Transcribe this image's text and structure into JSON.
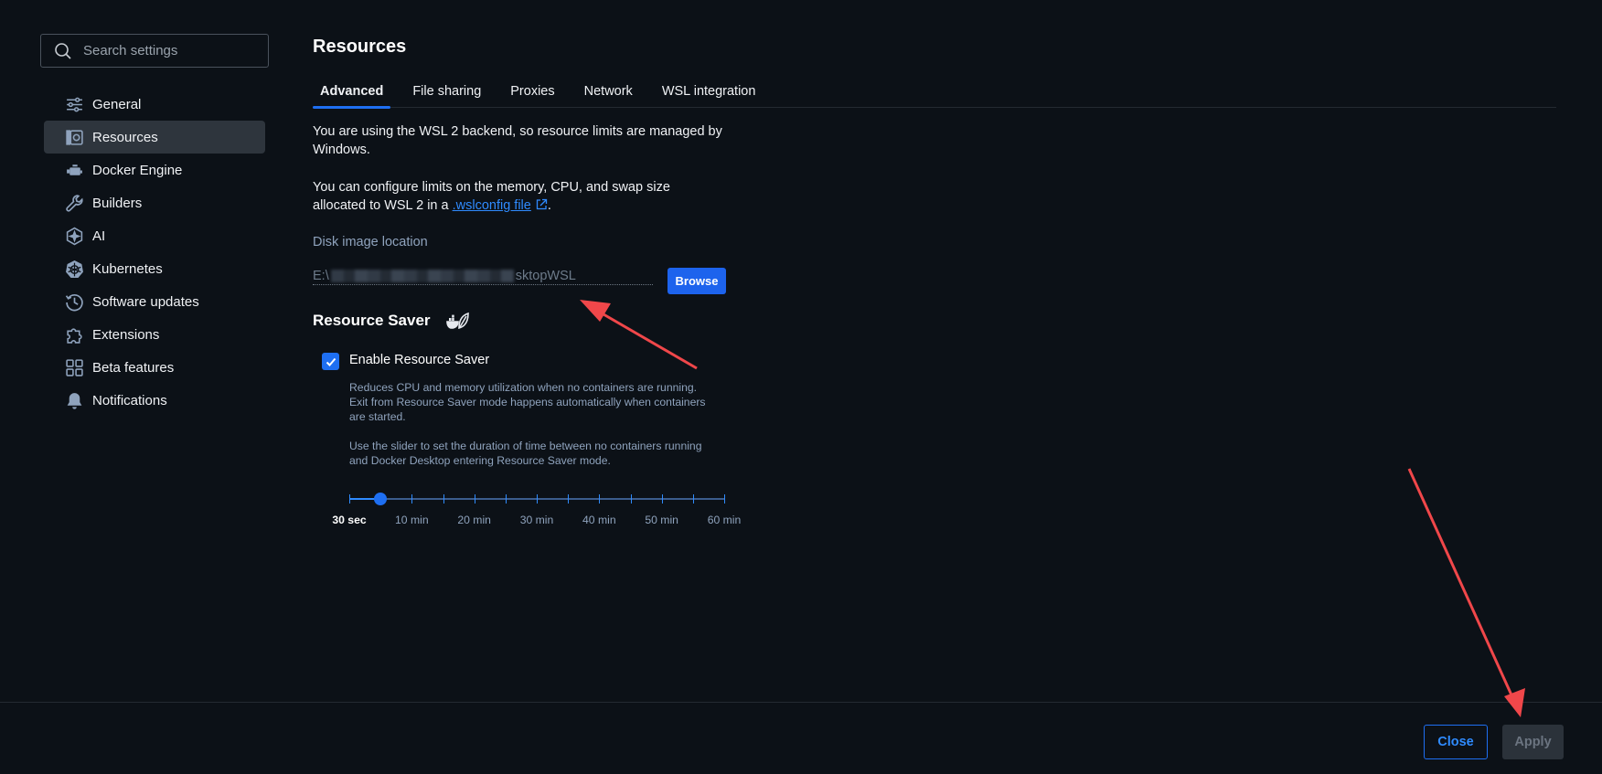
{
  "sidebar": {
    "search_placeholder": "Search settings",
    "items": [
      {
        "label": "General",
        "icon": "sliders-icon"
      },
      {
        "label": "Resources",
        "icon": "resources-icon",
        "active": true
      },
      {
        "label": "Docker Engine",
        "icon": "docker-engine-icon"
      },
      {
        "label": "Builders",
        "icon": "wrench-icon"
      },
      {
        "label": "AI",
        "icon": "ai-icon"
      },
      {
        "label": "Kubernetes",
        "icon": "kubernetes-icon"
      },
      {
        "label": "Software updates",
        "icon": "clock-icon"
      },
      {
        "label": "Extensions",
        "icon": "puzzle-icon"
      },
      {
        "label": "Beta features",
        "icon": "grid-icon"
      },
      {
        "label": "Notifications",
        "icon": "bell-icon"
      }
    ]
  },
  "main": {
    "title": "Resources",
    "tabs": [
      {
        "label": "Advanced",
        "active": true
      },
      {
        "label": "File sharing"
      },
      {
        "label": "Proxies"
      },
      {
        "label": "Network"
      },
      {
        "label": "WSL integration"
      }
    ],
    "wsl_text_1": "You are using the WSL 2 backend, so resource limits are managed by",
    "wsl_text_1b": "Windows.",
    "wsl_text_2a": "You can configure limits on the memory, CPU, and swap size",
    "wsl_text_2b": "allocated to WSL 2 in a ",
    "wsl_link": ".wslconfig file",
    "wsl_text_2c": ".",
    "disk_label": "Disk image location",
    "disk_path_prefix": "E:\\",
    "disk_path_suffix": "sktopWSL",
    "browse_label": "Browse",
    "resource_saver": {
      "title": "Resource Saver",
      "checkbox_label": "Enable Resource Saver",
      "enabled": true,
      "desc_1": [
        "Reduces CPU and memory utilization when no containers are running.",
        "Exit from Resource Saver mode happens automatically when containers",
        "are started."
      ],
      "desc_2": [
        "Use the slider to set the duration of time between no containers running",
        "and Docker Desktop entering Resource Saver mode."
      ],
      "slider": {
        "labels": [
          "30 sec",
          "10 min",
          "20 min",
          "30 min",
          "40 min",
          "50 min",
          "60 min"
        ],
        "steps": 13,
        "value_index": 1
      }
    }
  },
  "footer": {
    "close_label": "Close",
    "apply_label": "Apply"
  },
  "colors": {
    "accent": "#1e6ff2",
    "background": "#0c1117",
    "annotation": "#f0474a"
  }
}
